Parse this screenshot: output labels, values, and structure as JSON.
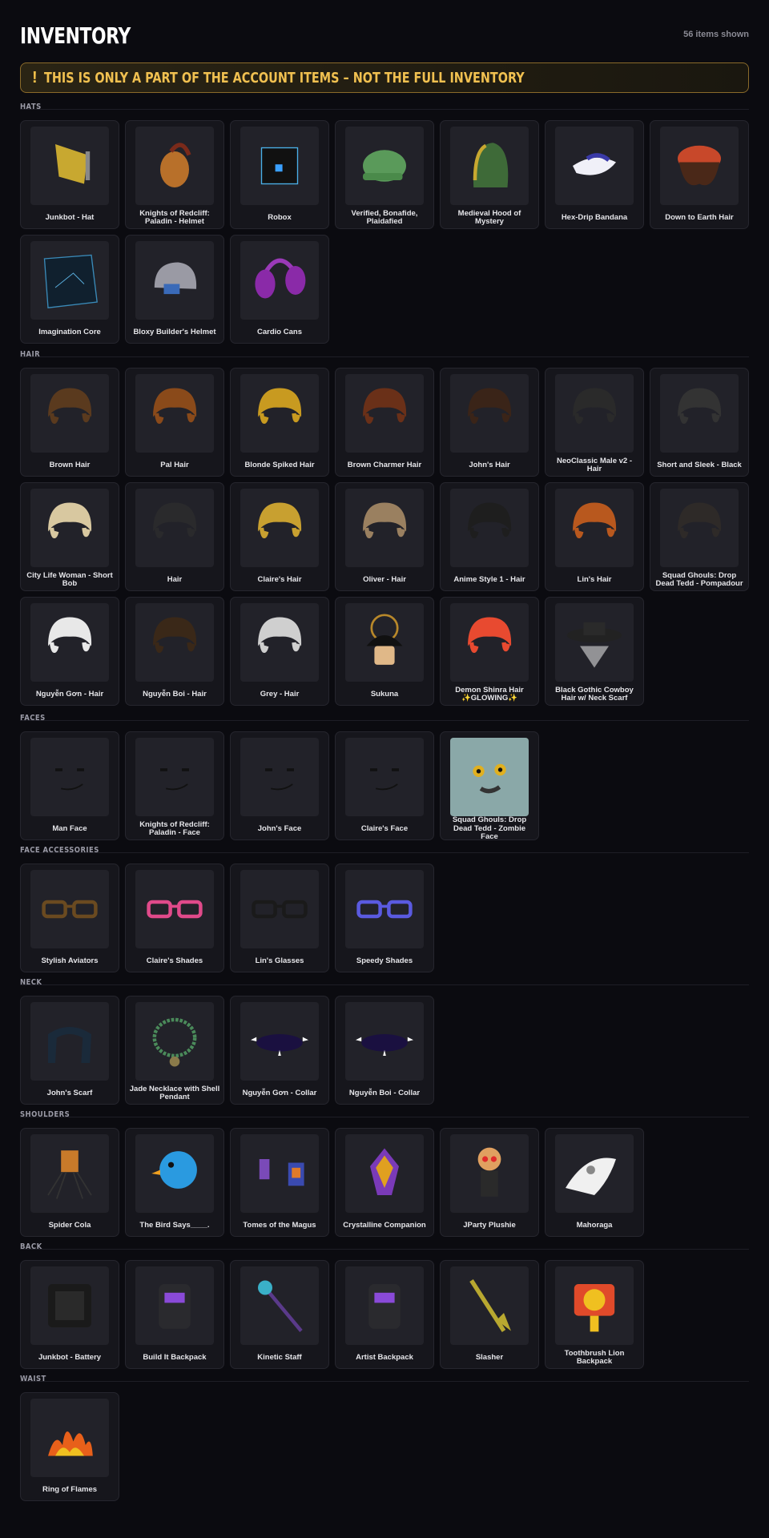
{
  "header": {
    "title": "INVENTORY",
    "count": "56 items shown"
  },
  "banner": {
    "icon": "!",
    "text": "THIS IS ONLY A PART OF THE ACCOUNT ITEMS – NOT THE FULL INVENTORY"
  },
  "sections": [
    {
      "name": "HATS",
      "items": [
        {
          "label": "Junkbot - Hat",
          "icon": "junkbot-hat-icon"
        },
        {
          "label": "Knights of Redcliff: Paladin - Helmet",
          "icon": "paladin-helmet-icon"
        },
        {
          "label": "Robox",
          "icon": "robox-icon"
        },
        {
          "label": "Verified, Bonafide, Plaidafied",
          "icon": "plaid-cap-icon"
        },
        {
          "label": "Medieval Hood of Mystery",
          "icon": "hood-icon"
        },
        {
          "label": "Hex-Drip Bandana",
          "icon": "bandana-icon"
        },
        {
          "label": "Down to Earth Hair",
          "icon": "beanie-hair-icon"
        },
        {
          "label": "Imagination Core",
          "icon": "cube-icon"
        },
        {
          "label": "Bloxy Builder's Helmet",
          "icon": "builder-helmet-icon"
        },
        {
          "label": "Cardio Cans",
          "icon": "earmuffs-icon"
        }
      ]
    },
    {
      "name": "HAIR",
      "items": [
        {
          "label": "Brown Hair",
          "icon": "hair-icon"
        },
        {
          "label": "Pal Hair",
          "icon": "hair-icon"
        },
        {
          "label": "Blonde Spiked Hair",
          "icon": "hair-icon"
        },
        {
          "label": "Brown Charmer Hair",
          "icon": "hair-icon"
        },
        {
          "label": "John's Hair",
          "icon": "hair-icon"
        },
        {
          "label": "NeoClassic Male v2 - Hair",
          "icon": "hair-icon"
        },
        {
          "label": "Short and Sleek - Black",
          "icon": "hair-icon"
        },
        {
          "label": "City Life Woman - Short Bob",
          "icon": "hair-icon"
        },
        {
          "label": "Hair",
          "icon": "hair-icon"
        },
        {
          "label": "Claire's Hair",
          "icon": "hair-icon"
        },
        {
          "label": "Oliver - Hair",
          "icon": "hair-icon"
        },
        {
          "label": "Anime Style 1 - Hair",
          "icon": "hair-icon"
        },
        {
          "label": "Lin's Hair",
          "icon": "hair-icon"
        },
        {
          "label": "Squad Ghouls: Drop Dead Tedd - Pompadour",
          "icon": "hair-icon"
        },
        {
          "label": "Nguyễn Gơn - Hair",
          "icon": "hair-icon"
        },
        {
          "label": "Nguyễn Boi - Hair",
          "icon": "hair-icon"
        },
        {
          "label": "Grey - Hair",
          "icon": "hair-icon"
        },
        {
          "label": "Sukuna",
          "icon": "sukuna-head-icon"
        },
        {
          "label": "Demon Shinra Hair ✨GLOWING✨",
          "icon": "hair-icon"
        },
        {
          "label": "Black Gothic Cowboy Hair w/ Neck Scarf",
          "icon": "cowboy-hat-icon"
        }
      ]
    },
    {
      "name": "FACES",
      "items": [
        {
          "label": "Man Face",
          "icon": "face-icon"
        },
        {
          "label": "Knights of Redcliff: Paladin - Face",
          "icon": "face-icon"
        },
        {
          "label": "John's Face",
          "icon": "face-icon"
        },
        {
          "label": "Claire's Face",
          "icon": "face-icon"
        },
        {
          "label": "Squad Ghouls: Drop Dead Tedd - Zombie Face",
          "icon": "zombie-face-icon"
        }
      ]
    },
    {
      "name": "FACE ACCESSORIES",
      "items": [
        {
          "label": "Stylish Aviators",
          "icon": "glasses-icon"
        },
        {
          "label": "Claire's Shades",
          "icon": "glasses-icon"
        },
        {
          "label": "Lin's Glasses",
          "icon": "glasses-icon"
        },
        {
          "label": "Speedy Shades",
          "icon": "glasses-icon"
        }
      ]
    },
    {
      "name": "NECK",
      "items": [
        {
          "label": "John's Scarf",
          "icon": "scarf-icon"
        },
        {
          "label": "Jade Necklace with Shell Pendant",
          "icon": "necklace-icon"
        },
        {
          "label": "Nguyễn Gơn - Collar",
          "icon": "collar-icon"
        },
        {
          "label": "Nguyễn Boi - Collar",
          "icon": "collar-icon"
        }
      ]
    },
    {
      "name": "SHOULDERS",
      "items": [
        {
          "label": "Spider Cola",
          "icon": "spider-icon"
        },
        {
          "label": "The Bird Says____.",
          "icon": "bird-icon"
        },
        {
          "label": "Tomes of the Magus",
          "icon": "books-icon"
        },
        {
          "label": "Crystalline Companion",
          "icon": "crystal-icon"
        },
        {
          "label": "JParty Plushie",
          "icon": "plushie-icon"
        },
        {
          "label": "Mahoraga",
          "icon": "mahoraga-icon"
        }
      ]
    },
    {
      "name": "BACK",
      "items": [
        {
          "label": "Junkbot - Battery",
          "icon": "battery-icon"
        },
        {
          "label": "Build It Backpack",
          "icon": "backpack-icon"
        },
        {
          "label": "Kinetic Staff",
          "icon": "staff-icon"
        },
        {
          "label": "Artist Backpack",
          "icon": "backpack-icon"
        },
        {
          "label": "Slasher",
          "icon": "slasher-icon"
        },
        {
          "label": "Toothbrush Lion Backpack",
          "icon": "lion-backpack-icon"
        }
      ]
    },
    {
      "name": "WAIST",
      "items": [
        {
          "label": "Ring of Flames",
          "icon": "flames-icon"
        }
      ]
    }
  ]
}
